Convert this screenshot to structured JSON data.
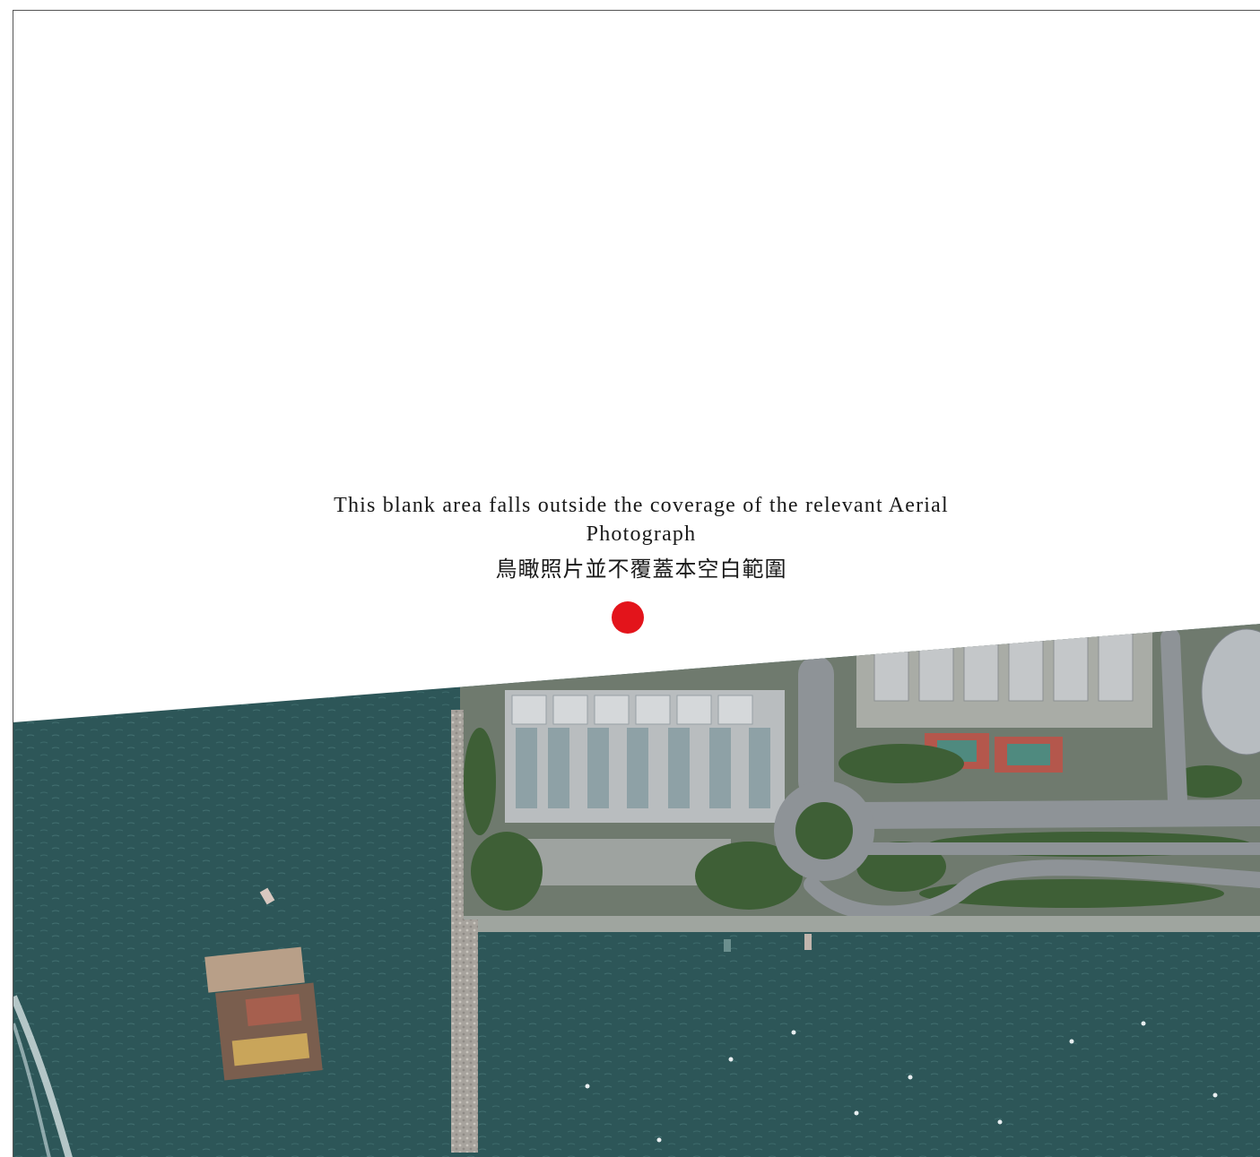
{
  "notice": {
    "english": "This blank area falls outside the coverage of the relevant Aerial Photograph",
    "chinese": "鳥瞰照片並不覆蓋本空白範圍"
  },
  "marker": {
    "icon": "location-dot-icon",
    "color": "#e3141b"
  },
  "colors": {
    "water": "#2d5658",
    "land": "#6f7a6e",
    "road": "#8e9397",
    "tree": "#3e5f36",
    "building": "#b9bdbf",
    "court": "#b4574c",
    "breakwater": "#a7a39d"
  },
  "features": {
    "top_area": "blank-uncovered-area",
    "photo_area": "aerial-photograph"
  }
}
